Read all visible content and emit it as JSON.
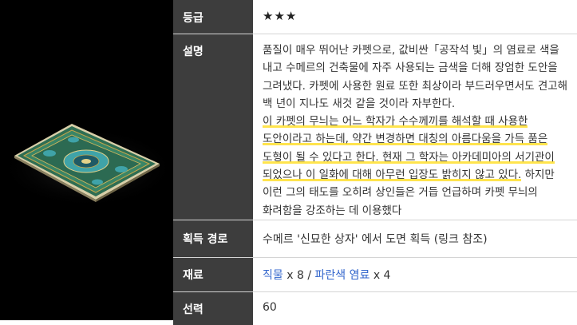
{
  "rows": {
    "rarity": {
      "label": "등급",
      "value": "★★★"
    },
    "description": {
      "label": "설명",
      "paragraph1": "품질이 매우 뛰어난 카펫으로, 값비싼「공작석 빛」의 염료로 색을 내고 수메르의 건축물에 자주 사용되는 금색을 더해 장엄한 도안을 그려냈다. 카펫에 사용한 원료 또한 최상이라 부드러우면서도 견고해 백 년이 지나도 새것 같을 것이라 자부한다.",
      "highlighted": "이 카펫의 무늬는 어느 학자가 수수께끼를 해석할 때 사용한 도안이라고 하는데, 약간 변경하면 대칭의 아름다움을 가득 품은 도형이 될 수 있다고 한다. 현재 그 학자는 아카데미아의 서기관이 되었으나 이 일화에 대해 아무런 입장도 밝히지 않고 있다.",
      "tail": " 하지만 이런 그의 태도를 오히려 상인들은 거듭 언급하며 카펫 무늬의 화려함을 강조하는 데 이용했다"
    },
    "source": {
      "label": "획득 경로",
      "value": "수메르 '신묘한 상자' 에서 도면 획득 (링크 참조)"
    },
    "materials": {
      "label": "재료",
      "items": [
        {
          "name": "직물",
          "qty": "x 8"
        },
        {
          "name": "파란색 염료",
          "qty": "x 4"
        }
      ],
      "separator": "/"
    },
    "favor": {
      "label": "선력",
      "value": "60"
    }
  },
  "colors": {
    "label_bg": "#3d3d3d",
    "link": "#3366cc",
    "highlight": "#ffe44d",
    "carpet_green": "#2f6e53",
    "carpet_teal": "#3fa3a8",
    "carpet_gold": "#c9a74a"
  }
}
